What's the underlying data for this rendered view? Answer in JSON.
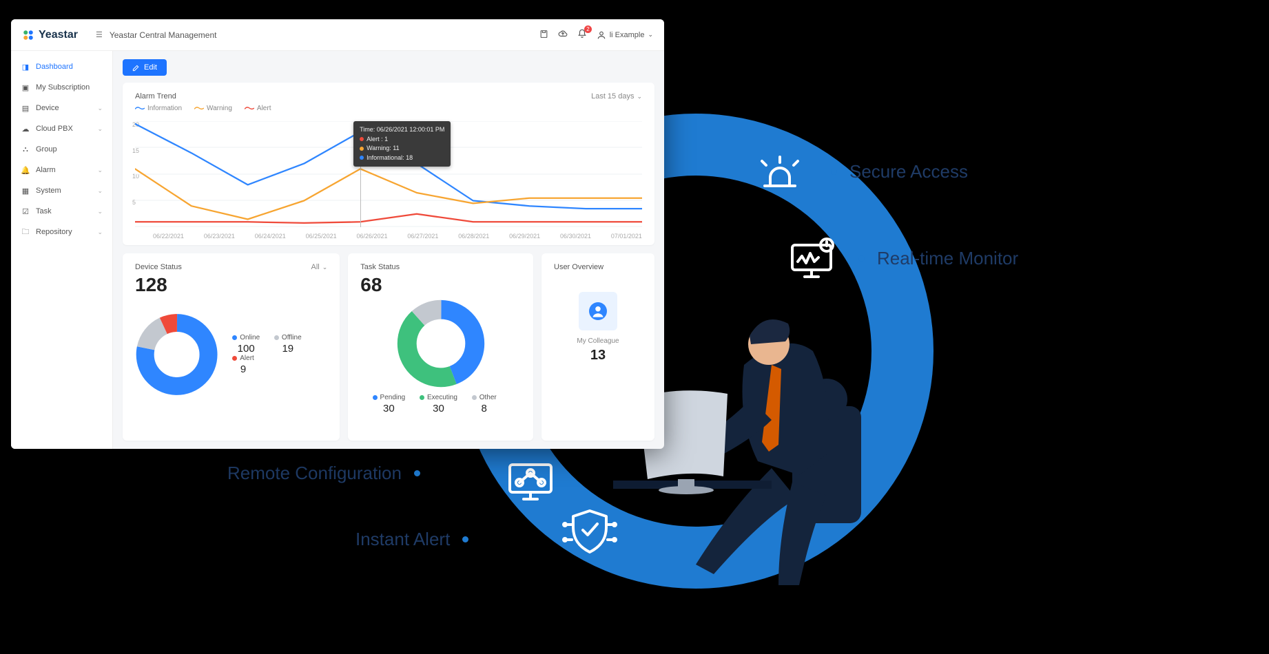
{
  "brand": "Yeastar",
  "page_title": "Yeastar Central Management",
  "notif_count": "2",
  "user_name": "li Example",
  "edit_label": "Edit",
  "sidebar": {
    "items": [
      {
        "label": "Dashboard",
        "active": true,
        "expand": false
      },
      {
        "label": "My Subscription",
        "active": false,
        "expand": false
      },
      {
        "label": "Device",
        "active": false,
        "expand": true
      },
      {
        "label": "Cloud PBX",
        "active": false,
        "expand": true
      },
      {
        "label": "Group",
        "active": false,
        "expand": false
      },
      {
        "label": "Alarm",
        "active": false,
        "expand": true
      },
      {
        "label": "System",
        "active": false,
        "expand": true
      },
      {
        "label": "Task",
        "active": false,
        "expand": true
      },
      {
        "label": "Repository",
        "active": false,
        "expand": true
      }
    ]
  },
  "alarm_card": {
    "title": "Alarm Trend",
    "range_label": "Last 15 days",
    "legend": {
      "info": "Information",
      "warn": "Warning",
      "alert": "Alert"
    },
    "tooltip": {
      "time": "Time: 06/26/2021 12:00:01 PM",
      "alert": "Alert : 1",
      "warn": "Warning: 11",
      "info": "Informational: 18"
    }
  },
  "device_card": {
    "title": "Device Status",
    "all_label": "All",
    "total": "128",
    "legend": {
      "online": "Online",
      "offline": "Offline",
      "alert": "Alert"
    },
    "values": {
      "online": "100",
      "offline": "19",
      "alert": "9"
    }
  },
  "task_card": {
    "title": "Task Status",
    "total": "68",
    "legend": {
      "pending": "Pending",
      "executing": "Executing",
      "other": "Other"
    },
    "values": {
      "pending": "30",
      "executing": "30",
      "other": "8"
    }
  },
  "user_card": {
    "title": "User Overview",
    "label": "My Colleague",
    "count": "13"
  },
  "features": {
    "secure": "Secure Access",
    "monitor": "Real-time Monitor",
    "remote": "Remote Configuration",
    "alert": "Instant Alert"
  },
  "colors": {
    "blue": "#2f86ff",
    "orange": "#f7a531",
    "red": "#ef4a3a",
    "grey": "#c3c8cf",
    "green": "#3ec17d",
    "ring": "#1f7bd1",
    "navy": "#14243c"
  },
  "chart_data": [
    {
      "type": "line",
      "title": "Alarm Trend",
      "xlabel": "",
      "ylabel": "",
      "ylim": [
        0,
        20
      ],
      "categories": [
        "06/22/2021",
        "06/23/2021",
        "06/24/2021",
        "06/25/2021",
        "06/26/2021",
        "06/27/2021",
        "06/28/2021",
        "06/29/2021",
        "06/30/2021",
        "07/01/2021"
      ],
      "series": [
        {
          "name": "Information",
          "color": "#2f86ff",
          "values": [
            19.5,
            14,
            8,
            12,
            18,
            12,
            5,
            4,
            3.5,
            3.5
          ]
        },
        {
          "name": "Warning",
          "color": "#f7a531",
          "values": [
            11,
            4,
            1.5,
            5,
            11,
            6.5,
            4.5,
            5.5,
            5.5,
            5.5
          ]
        },
        {
          "name": "Alert",
          "color": "#ef4a3a",
          "values": [
            1,
            1,
            1,
            0.8,
            1,
            2.5,
            1,
            1,
            1,
            1
          ]
        }
      ],
      "tooltip_at": "06/26/2021",
      "tooltip": {
        "Alert": 1,
        "Warning": 11,
        "Informational": 18
      }
    },
    {
      "type": "pie",
      "title": "Device Status",
      "total": 128,
      "series": [
        {
          "name": "Online",
          "value": 100,
          "color": "#2f86ff"
        },
        {
          "name": "Offline",
          "value": 19,
          "color": "#c3c8cf"
        },
        {
          "name": "Alert",
          "value": 9,
          "color": "#ef4a3a"
        }
      ]
    },
    {
      "type": "pie",
      "title": "Task Status",
      "total": 68,
      "series": [
        {
          "name": "Pending",
          "value": 30,
          "color": "#2f86ff"
        },
        {
          "name": "Executing",
          "value": 30,
          "color": "#3ec17d"
        },
        {
          "name": "Other",
          "value": 8,
          "color": "#c3c8cf"
        }
      ]
    }
  ]
}
